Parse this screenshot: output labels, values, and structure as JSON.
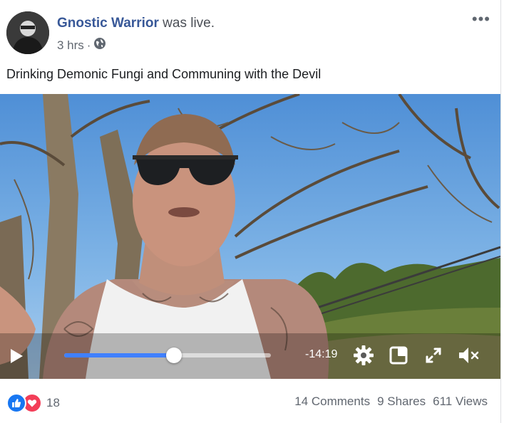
{
  "post": {
    "author": "Gnostic Warrior",
    "author_suffix": "was live.",
    "time": "3 hrs",
    "separator": "·",
    "privacy_icon": "globe-icon",
    "caption": "Drinking Demonic Fungi and Communing with the Devil"
  },
  "video": {
    "progress": 0.53,
    "time_remaining": "-14:19",
    "controls": [
      "play-icon",
      "settings-icon",
      "fullscreen-icon",
      "expand-icon",
      "mute-icon"
    ]
  },
  "footer": {
    "reactions": [
      "like-icon",
      "love-icon"
    ],
    "reaction_count": "18",
    "comments": "14 Comments",
    "shares": "9 Shares",
    "views": "611 Views"
  },
  "colors": {
    "link": "#385898",
    "accent": "#4080ff",
    "like": "#1877f2",
    "love": "#f33e58"
  }
}
